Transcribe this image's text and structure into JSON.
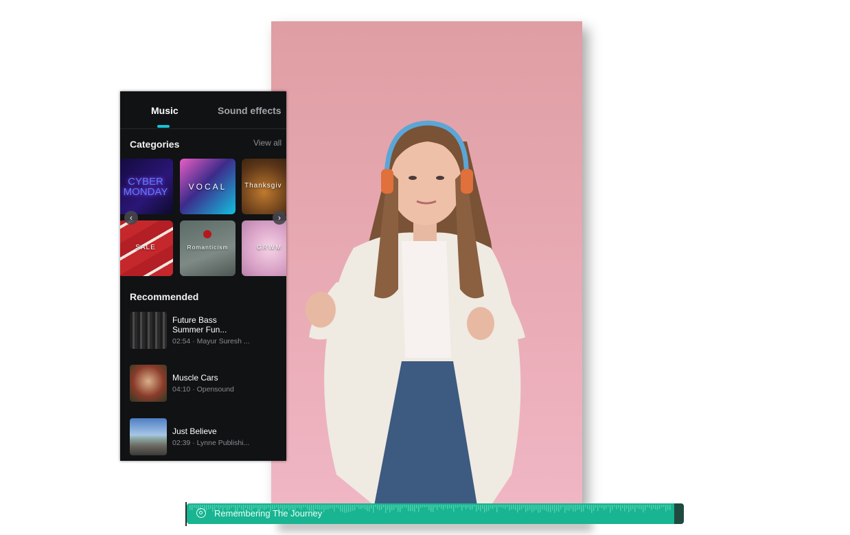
{
  "tabs": {
    "music": "Music",
    "sound_effects": "Sound effects"
  },
  "categories": {
    "title": "Categories",
    "view_all": "View all",
    "tiles": [
      {
        "label": "CYBER MONDAY"
      },
      {
        "label": "VOCAL"
      },
      {
        "label": "Thanksgiv"
      },
      {
        "label": "SALE"
      },
      {
        "label": "Romanticism"
      },
      {
        "label": "GRWM"
      }
    ]
  },
  "recommended": {
    "title": "Recommended",
    "tracks": [
      {
        "title": "Future Bass Summer Fun...",
        "meta": "02:54 · Mayur Suresh ..."
      },
      {
        "title": "Muscle Cars",
        "meta": "04:10 · Opensound"
      },
      {
        "title": "Just Believe",
        "meta": "02:39 · Lynne Publishi..."
      }
    ]
  },
  "audio_track": {
    "label": "Remembering The Journey"
  },
  "colors": {
    "accent": "#17c3d8",
    "audio": "#19b491",
    "panel_bg": "#111214"
  }
}
